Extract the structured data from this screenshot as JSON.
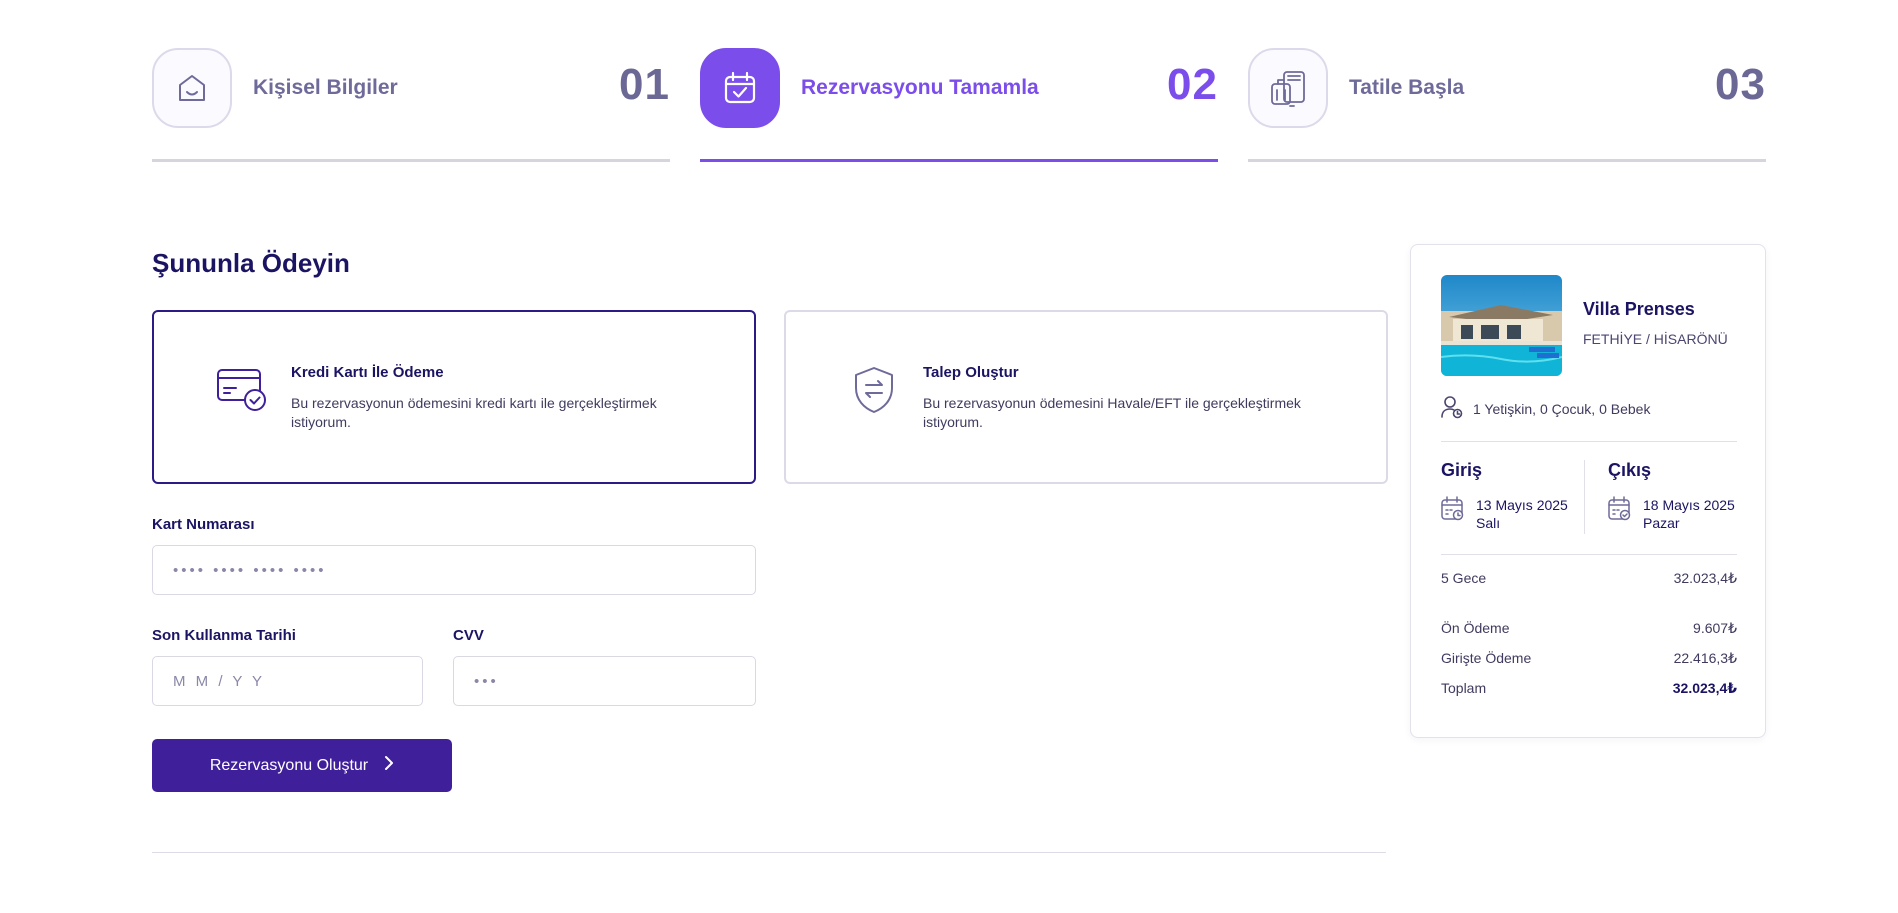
{
  "stepper": [
    {
      "label": "Kişisel Bilgiler",
      "number": "01",
      "icon": "home-icon",
      "active": false
    },
    {
      "label": "Rezervasyonu Tamamla",
      "number": "02",
      "icon": "calendar-check-icon",
      "active": true
    },
    {
      "label": "Tatile Başla",
      "number": "03",
      "icon": "luggage-icon",
      "active": false
    }
  ],
  "colors": {
    "accent": "#7b4dea",
    "primary": "#40209a",
    "text": "#1b1463"
  },
  "payment": {
    "title": "Şununla Ödeyin",
    "options": [
      {
        "title": "Kredi Kartı İle Ödeme",
        "desc": "Bu rezervasyonun ödemesini kredi kartı ile gerçekleştirmek istiyorum.",
        "icon": "credit-card-icon",
        "selected": true
      },
      {
        "title": "Talep Oluştur",
        "desc": "Bu rezervasyonun ödemesini Havale/EFT ile gerçekleştirmek istiyorum.",
        "icon": "shield-transfer-icon",
        "selected": false
      }
    ],
    "card_number": {
      "label": "Kart Numarası",
      "placeholder": "•••• •••• •••• ••••",
      "value": ""
    },
    "expiry": {
      "label": "Son Kullanma Tarihi",
      "placeholder": "M M / Y Y",
      "value": ""
    },
    "cvv": {
      "label": "CVV",
      "placeholder": "•••",
      "value": ""
    },
    "submit_label": "Rezervasyonu Oluştur"
  },
  "summary": {
    "villa_name": "Villa Prenses",
    "location": "FETHİYE / HİSARÖNÜ",
    "guests": "1 Yetişkin, 0 Çocuk, 0 Bebek",
    "checkin": {
      "title": "Giriş",
      "date": "13 Mayıs 2025",
      "day": "Salı"
    },
    "checkout": {
      "title": "Çıkış",
      "date": "18 Mayıs 2025",
      "day": "Pazar"
    },
    "nights": {
      "label": "5 Gece",
      "value": "32.023,4₺"
    },
    "prepayment": {
      "label": "Ön Ödeme",
      "value": "9.607₺"
    },
    "checkin_payment": {
      "label": "Girişte Ödeme",
      "value": "22.416,3₺"
    },
    "total": {
      "label": "Toplam",
      "value": "32.023,4₺"
    }
  }
}
